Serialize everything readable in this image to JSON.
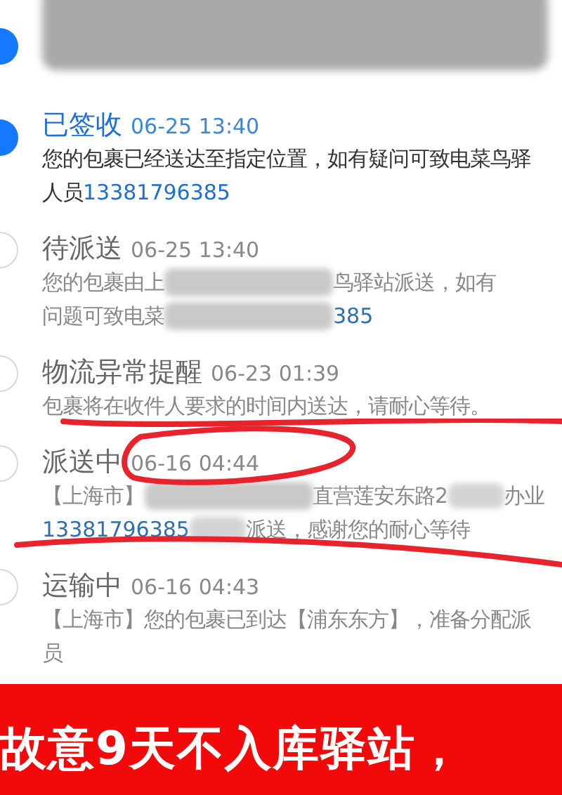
{
  "events": [
    {
      "done": true,
      "lines": [
        [
          {
            "kind": "redacted"
          }
        ]
      ]
    },
    {
      "done": true,
      "status": "已签收",
      "time": "06-25 13:40",
      "lines": [
        [
          {
            "kind": "text",
            "text": "您的包裹已经送达至指定位置，如有疑问可致电菜鸟驿"
          }
        ],
        [
          {
            "kind": "text",
            "text": "人员 "
          },
          {
            "kind": "phone",
            "text": "13381796385"
          }
        ]
      ]
    },
    {
      "done": false,
      "status": "待派送",
      "time": "06-25 13:40",
      "lines": [
        [
          {
            "kind": "text",
            "text": "您的包裹由上"
          },
          {
            "kind": "redacted"
          },
          {
            "kind": "text",
            "text": "鸟驿站派送，如有"
          }
        ],
        [
          {
            "kind": "text",
            "text": "问题可致电菜"
          },
          {
            "kind": "redacted"
          },
          {
            "kind": "phone",
            "text": "385"
          }
        ]
      ]
    },
    {
      "done": false,
      "status": "物流异常提醒",
      "time": "06-23 01:39",
      "lines": [
        [
          {
            "kind": "text",
            "text": "包裹将在收件人要求的时间内送达，请耐心等待。"
          }
        ]
      ]
    },
    {
      "done": false,
      "status": "派送中",
      "time": "06-16 04:44",
      "lines": [
        [
          {
            "kind": "text",
            "text": "【上海市】"
          },
          {
            "kind": "redacted"
          },
          {
            "kind": "text",
            "text": "直营莲安东路2"
          },
          {
            "kind": "redacted_small"
          },
          {
            "kind": "text",
            "text": "办业"
          }
        ],
        [
          {
            "kind": "phone",
            "text": "13381796385"
          },
          {
            "kind": "redacted_small"
          },
          {
            "kind": "text",
            "text": "派送，感谢您的耐心等待"
          }
        ]
      ]
    },
    {
      "done": false,
      "status": "运输中",
      "time": "06-16 04:43",
      "lines": [
        [
          {
            "kind": "text",
            "text": "【上海市】您的包裹已到达【浦东东方】，准备分配派"
          }
        ],
        [
          {
            "kind": "text",
            "text": "员"
          }
        ]
      ]
    }
  ],
  "banner": {
    "text": "故意9天不入库驿站，"
  }
}
